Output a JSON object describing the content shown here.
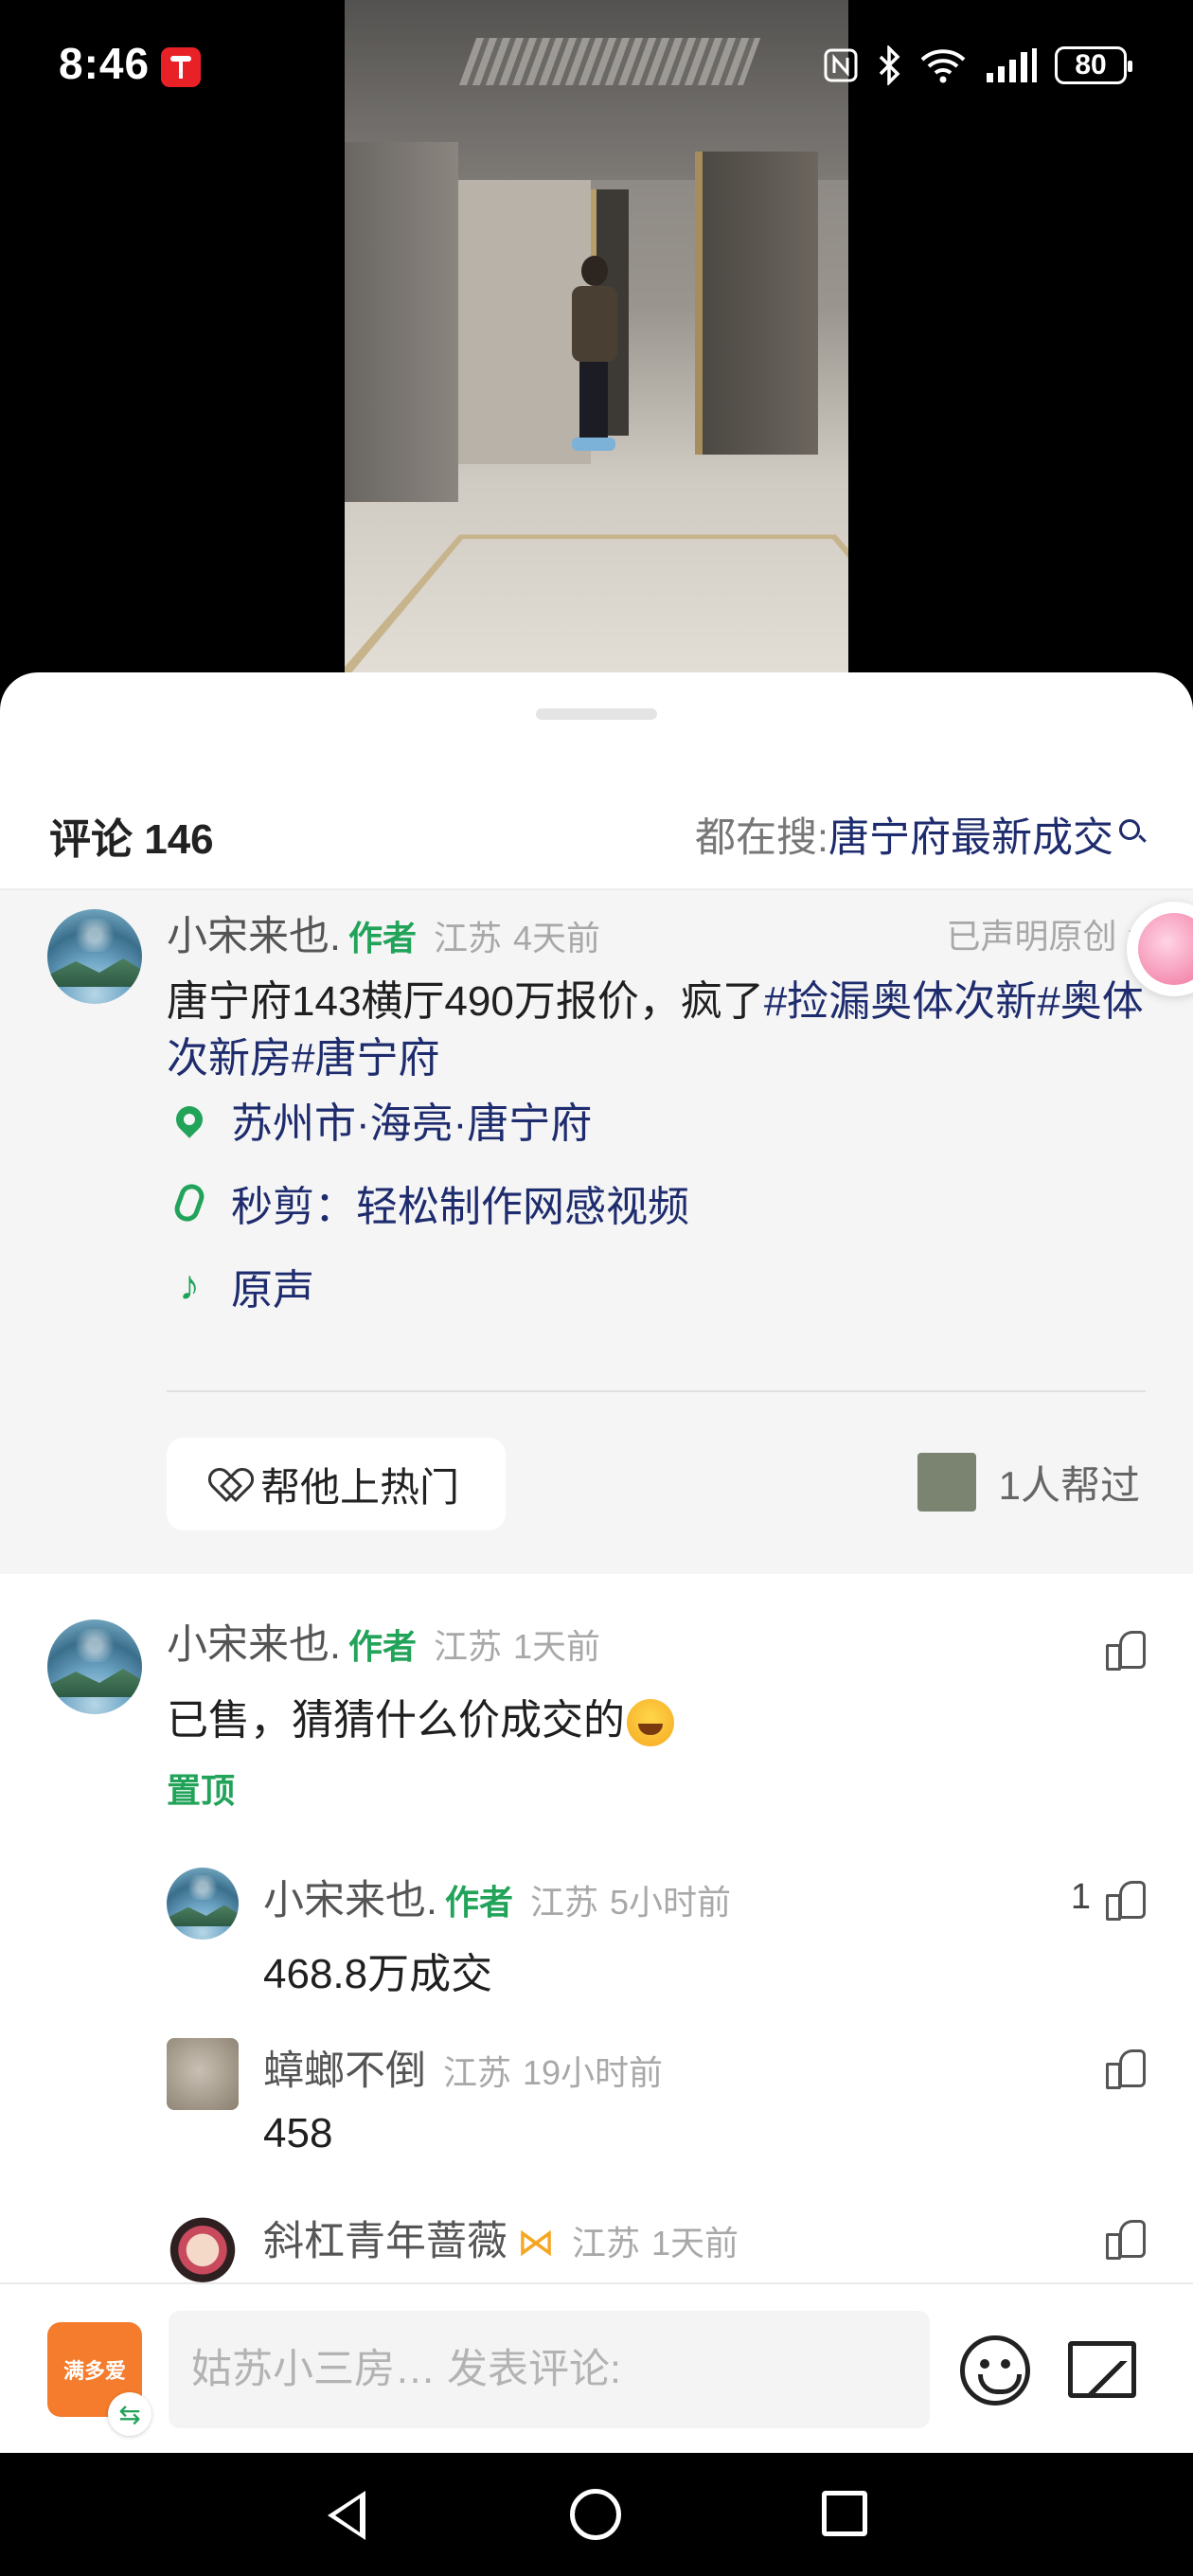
{
  "status_bar": {
    "time": "8:46",
    "battery": "80"
  },
  "header": {
    "comment_count_label": "评论 146",
    "trending_prefix": "都在搜: ",
    "trending_query": "唐宁府最新成交"
  },
  "post": {
    "username": "小宋来也.",
    "author_tag": "作者",
    "location": "江苏",
    "time": "4天前",
    "original_claim": "已声明原创",
    "title_text": "唐宁府143横厅490万报价，疯了",
    "hashtag_1": "#捡漏奥体次新#",
    "hashtag_2": "奥体次新房#唐宁府",
    "place": "苏州市·海亮·唐宁府",
    "editor": "秒剪：轻松制作网感视频",
    "music": "原声",
    "boost_label": "帮他上热门",
    "helpers_label": "1人帮过"
  },
  "comments": [
    {
      "username": "小宋来也.",
      "author_tag": "作者",
      "location": "江苏",
      "time": "1天前",
      "text": "已售，猜猜什么价成交的",
      "pinned_label": "置顶",
      "likes": ""
    }
  ],
  "replies": [
    {
      "username": "小宋来也.",
      "author_tag": "作者",
      "location": "江苏",
      "time": "5小时前",
      "text": "468.8万成交",
      "likes": "1"
    },
    {
      "username": "蟑螂不倒",
      "author_tag": "",
      "location": "江苏",
      "time": "19小时前",
      "text": "458",
      "likes": ""
    },
    {
      "username": "斜杠青年蔷薇",
      "author_tag": "",
      "location": "江苏",
      "time": "1天前",
      "text": "",
      "likes": ""
    }
  ],
  "input_bar": {
    "app_logo_text": "满多爱",
    "placeholder": "姑苏小三房… 发表评论:"
  },
  "icons": {
    "location": "map-pin-icon",
    "editor": "clip-icon",
    "music": "music-note-icon",
    "like": "thumb-up-icon",
    "boost": "heart-icon"
  },
  "colors": {
    "accent_green": "#22a35a",
    "link_navy": "#1e2c6e",
    "app_orange": "#f47c2c"
  }
}
